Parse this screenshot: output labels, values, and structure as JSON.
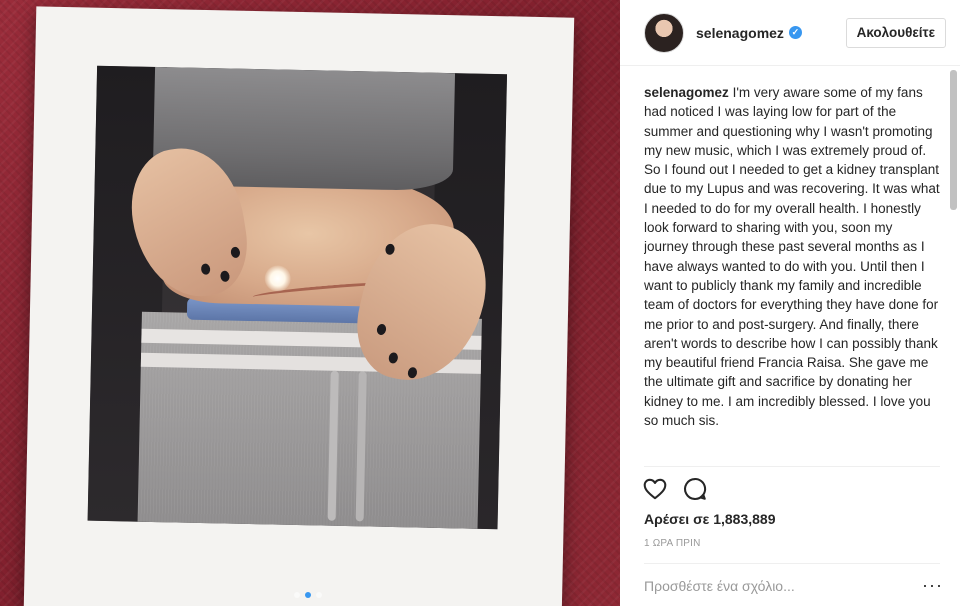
{
  "colors": {
    "accent": "#3897f0",
    "background": "#8b2632",
    "text": "#262626",
    "muted": "#999999"
  },
  "photo": {
    "carousel": {
      "count": 3,
      "active_index": 1
    }
  },
  "header": {
    "username": "selenagomez",
    "verified_icon": "verified-badge-icon",
    "follow_label": "Ακολουθείτε"
  },
  "caption": {
    "username": "selenagomez",
    "text": "I'm very aware some of my fans had noticed I was laying low for part of the summer and questioning why I wasn't promoting my new music, which I was extremely proud of. So I found out I needed to get a kidney transplant due to my Lupus and was recovering. It was what I needed to do for my overall health. I honestly look forward to sharing with you, soon my journey through these past several months as I have always wanted to do with you. Until then I want to publicly thank my family and incredible team of doctors for everything they have done for me prior to and post-surgery. And finally, there aren't words to describe how I can possibly thank my beautiful friend Francia Raisa. She gave me the ultimate gift and sacrifice by donating her kidney to me. I am incredibly blessed. I love you so much sis."
  },
  "actions": {
    "like_icon": "heart-icon",
    "comment_icon": "comment-icon"
  },
  "likes": {
    "text": "Αρέσει σε 1,883,889"
  },
  "timestamp": "1 ΩΡΑ ΠΡΙΝ",
  "comment": {
    "placeholder": "Προσθέστε ένα σχόλιο...",
    "more_label": "···"
  }
}
